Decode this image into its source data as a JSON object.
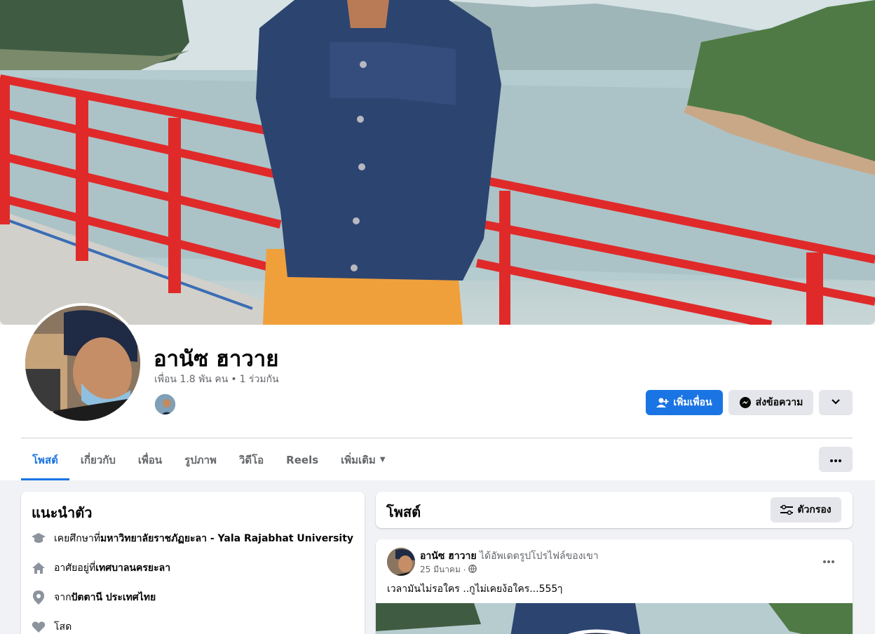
{
  "profile": {
    "name": "อานัซ ฮาวาย",
    "friends": "เพื่อน 1.8 พัน คน",
    "mutual": "1 ร่วมกัน"
  },
  "actions": {
    "add_friend": "เพิ่มเพื่อน",
    "message": "ส่งข้อความ"
  },
  "tabs": [
    {
      "label": "โพสต์",
      "active": true
    },
    {
      "label": "เกี่ยวกับ"
    },
    {
      "label": "เพื่อน"
    },
    {
      "label": "รูปภาพ"
    },
    {
      "label": "วิดีโอ"
    },
    {
      "label": "Reels"
    },
    {
      "label": "เพิ่มเติม"
    }
  ],
  "intro": {
    "title": "แนะนำตัว",
    "items": [
      {
        "icon": "graduation-cap-icon",
        "prefix": "เคยศึกษาที่ ",
        "value": "มหาวิทยาลัยราชภัฏยะลา - Yala Rajabhat University"
      },
      {
        "icon": "home-icon",
        "prefix": "อาศัยอยู่ที่ ",
        "value": "เทศบาลนครยะลา"
      },
      {
        "icon": "location-pin-icon",
        "prefix": "จาก ",
        "value": "ปัตตานี ประเทศไทย"
      },
      {
        "icon": "heart-icon",
        "prefix": "โสด",
        "value": ""
      }
    ]
  },
  "posts_header": {
    "title": "โพสต์",
    "filter": "ตัวกรอง"
  },
  "post": {
    "author": "อานัซ ฮาวาย",
    "action": "ได้อัพเดตรูปโปรไฟล์ของเขา",
    "date": "25 มีนาคม",
    "separator": "·",
    "text": "เวลามันไม่รอใคร  ..กูไม่เคยง้อใคร...555ๅ"
  },
  "colors": {
    "primary": "#1b74e4",
    "button_gray": "#e4e6eb",
    "text_secondary": "#65676b",
    "page_bg": "#f0f2f5",
    "railing_red": "#e02a2a"
  }
}
